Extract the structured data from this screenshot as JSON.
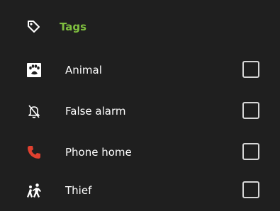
{
  "header": {
    "title": "Tags",
    "icon": "tag-icon",
    "title_color": "#7fbf3f"
  },
  "items": [
    {
      "label": "Animal",
      "icon": "paw-icon",
      "checked": false
    },
    {
      "label": "False alarm",
      "icon": "bell-off-icon",
      "checked": false
    },
    {
      "label": "Phone home",
      "icon": "phone-icon",
      "icon_color": "#e0402f",
      "checked": false
    },
    {
      "label": "Thief",
      "icon": "thief-icon",
      "checked": false
    }
  ]
}
